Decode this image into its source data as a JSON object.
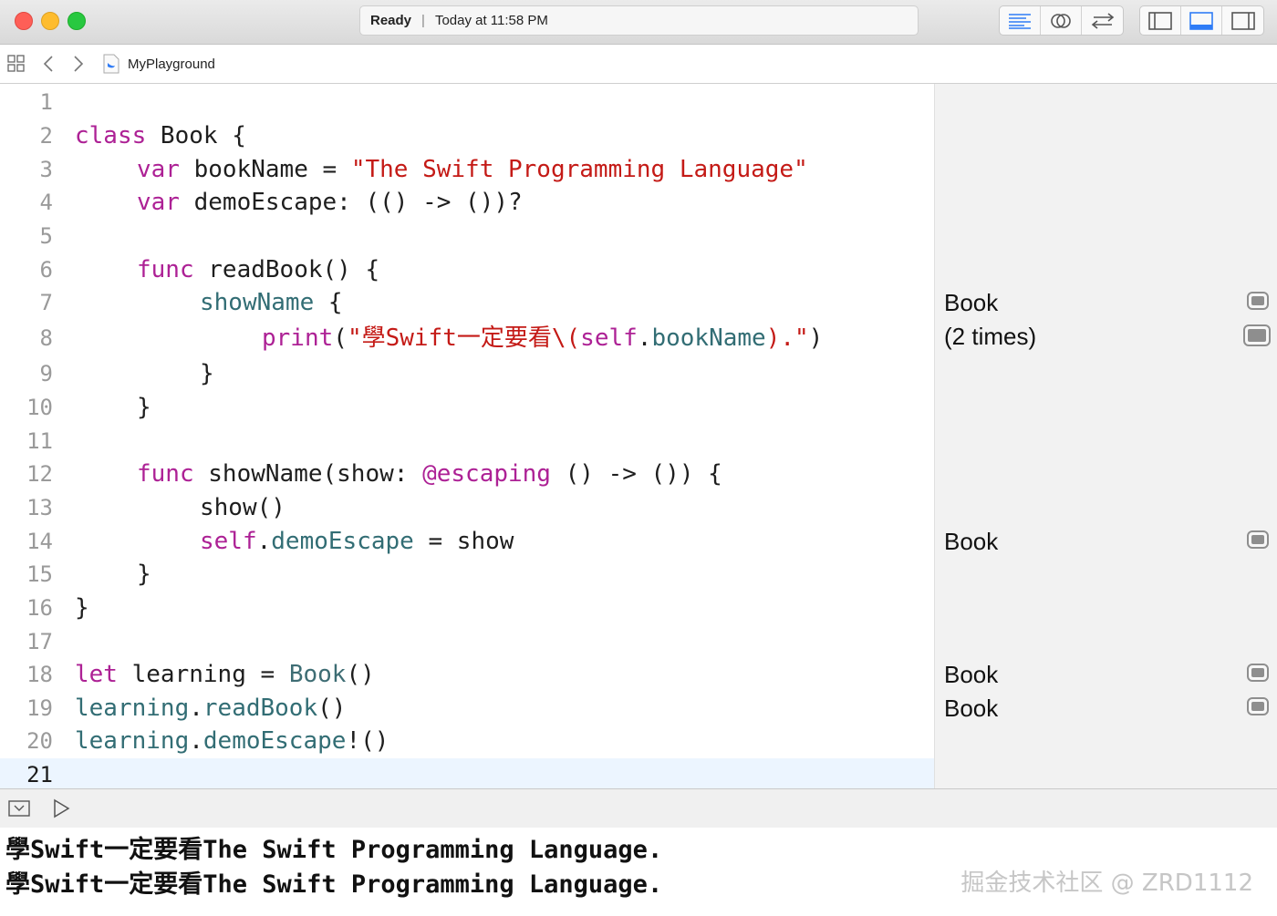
{
  "window": {
    "activity_status": "Ready",
    "activity_time": "Today at 11:58 PM"
  },
  "jumpbar": {
    "file": "MyPlayground"
  },
  "editor": {
    "current_line": 21,
    "lines": [
      {
        "n": "1"
      },
      {
        "n": "2"
      },
      {
        "n": "3"
      },
      {
        "n": "4"
      },
      {
        "n": "5"
      },
      {
        "n": "6"
      },
      {
        "n": "7"
      },
      {
        "n": "8"
      },
      {
        "n": "9"
      },
      {
        "n": "10"
      },
      {
        "n": "11"
      },
      {
        "n": "12"
      },
      {
        "n": "13"
      },
      {
        "n": "14"
      },
      {
        "n": "15"
      },
      {
        "n": "16"
      },
      {
        "n": "17"
      },
      {
        "n": "18"
      },
      {
        "n": "19"
      },
      {
        "n": "20"
      },
      {
        "n": "21"
      }
    ],
    "code": {
      "l2": [
        "class",
        " Book {"
      ],
      "l3": [
        "var",
        " bookName = ",
        "\"The Swift Programming Language\""
      ],
      "l4": [
        "var",
        " demoEscape: (() -> ())?"
      ],
      "l6": [
        "func",
        " readBook() {"
      ],
      "l7": [
        "showName",
        " {"
      ],
      "l8": [
        "print",
        "(",
        "\"學Swift一定要看\\(",
        "self",
        ".",
        "bookName",
        ").\"",
        ")"
      ],
      "l9": [
        "}"
      ],
      "l10": [
        "}"
      ],
      "l12": [
        "func",
        " showName(show: ",
        "@escaping",
        " () -> ()) {"
      ],
      "l13": [
        "show()"
      ],
      "l14": [
        "self",
        ".",
        "demoEscape",
        " = show"
      ],
      "l15": [
        "}"
      ],
      "l16": [
        "}"
      ],
      "l18": [
        "let",
        " learning = ",
        "Book",
        "()"
      ],
      "l19": [
        "learning",
        ".",
        "readBook",
        "()"
      ],
      "l20": [
        "learning",
        ".",
        "demoEscape",
        "!()"
      ]
    }
  },
  "results": [
    {
      "line": 7,
      "text": "Book"
    },
    {
      "line": 8,
      "text": "(2 times)"
    },
    {
      "line": 14,
      "text": "Book"
    },
    {
      "line": 18,
      "text": "Book"
    },
    {
      "line": 19,
      "text": "Book"
    }
  ],
  "console": {
    "lines": [
      "學Swift一定要看The Swift Programming Language.",
      "學Swift一定要看The Swift Programming Language."
    ],
    "watermark": "掘金技术社区 @ ZRD1112"
  },
  "colors": {
    "keyword": "#ad2195",
    "string": "#c41a16",
    "function": "#326d74"
  },
  "icons": {
    "toolbar_left": [
      "standard-editor-icon",
      "assistant-editor-icon",
      "version-editor-icon"
    ],
    "toolbar_right": [
      "navigator-toggle-icon",
      "debug-area-toggle-icon",
      "utilities-toggle-icon"
    ]
  }
}
